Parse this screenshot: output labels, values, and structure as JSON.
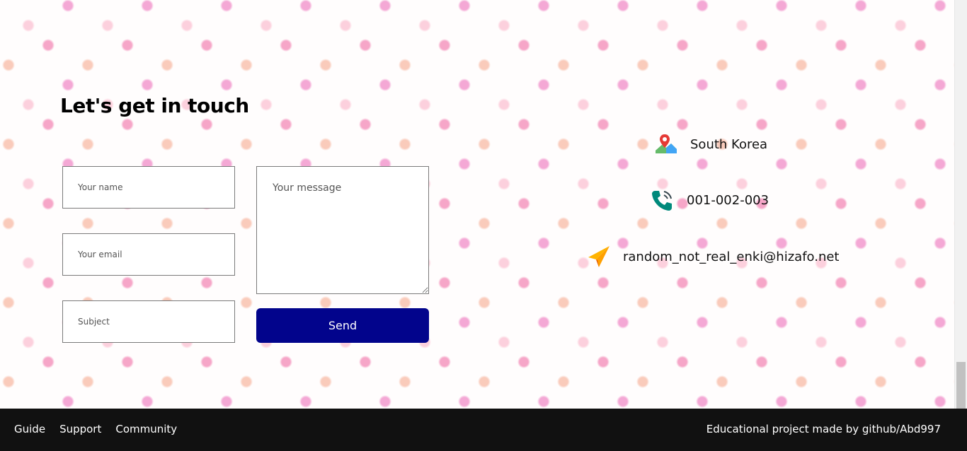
{
  "contact": {
    "title": "Let's get in touch",
    "form": {
      "name_placeholder": "Your name",
      "email_placeholder": "Your email",
      "subject_placeholder": "Subject",
      "message_placeholder": "Your message",
      "send_label": "Send"
    },
    "info": {
      "location": "South Korea",
      "location_icon": "map-pin-icon",
      "phone": "001-002-003",
      "phone_icon": "phone-icon",
      "email": "random_not_real_enki@hizafo.net",
      "email_icon": "paper-plane-icon"
    }
  },
  "footer": {
    "links": [
      "Guide",
      "Support",
      "Community"
    ],
    "credit": "Educational project made by github/Abd997"
  },
  "colors": {
    "send_button": "#02048c",
    "footer_bg": "#111111",
    "dots": "#f496be"
  }
}
